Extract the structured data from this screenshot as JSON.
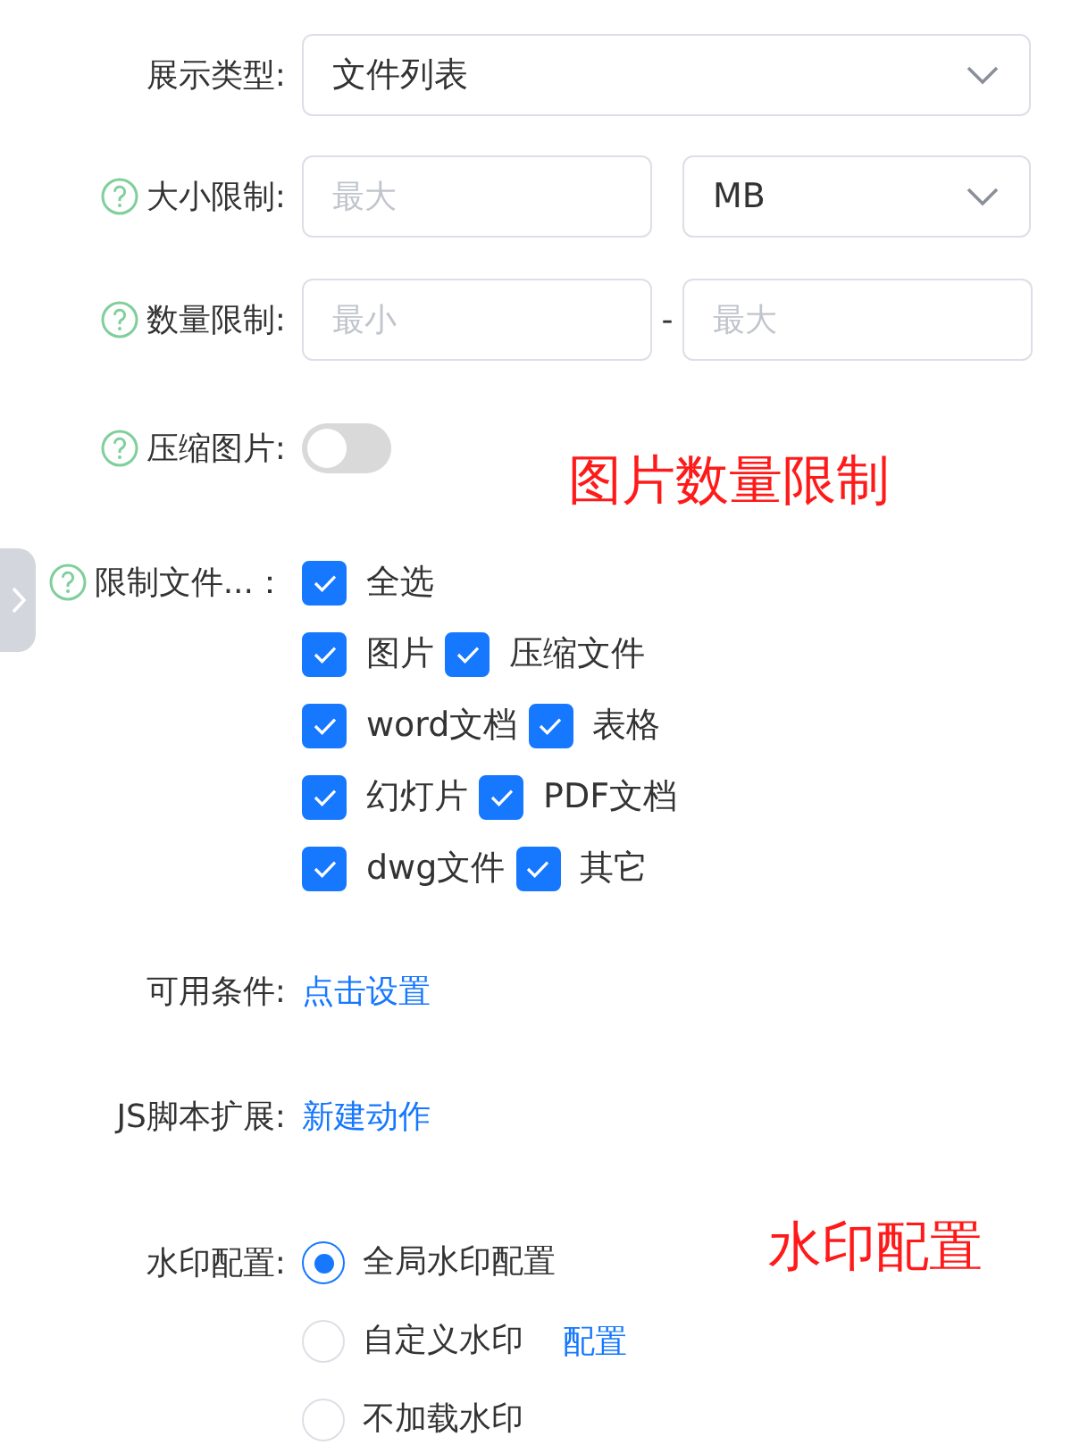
{
  "rows": [
    {
      "kind": "select",
      "label": "展示类型:",
      "help": false,
      "value": "文件列表"
    },
    {
      "kind": "size",
      "label": "大小限制:",
      "help": true,
      "placeholder": "最大",
      "unit": "MB"
    },
    {
      "kind": "range",
      "label": "数量限制:",
      "help": true,
      "min_placeholder": "最小",
      "separator": "-",
      "max_placeholder": "最大"
    },
    {
      "kind": "switch",
      "label": "压缩图片:",
      "help": true,
      "on": false,
      "annotation": "图片数量限制"
    },
    {
      "kind": "checkboxes",
      "label": "限制文件...：",
      "help": true,
      "lines": [
        [
          {
            "label": "全选",
            "checked": true
          }
        ],
        [
          {
            "label": "图片",
            "checked": true
          },
          {
            "label": "压缩文件",
            "checked": true
          }
        ],
        [
          {
            "label": "word文档",
            "checked": true
          },
          {
            "label": "表格",
            "checked": true
          }
        ],
        [
          {
            "label": "幻灯片",
            "checked": true
          },
          {
            "label": "PDF文档",
            "checked": true
          }
        ],
        [
          {
            "label": "dwg文件",
            "checked": true
          },
          {
            "label": "其它",
            "checked": true
          }
        ]
      ]
    },
    {
      "kind": "link",
      "label": "可用条件:",
      "help": false,
      "link": "点击设置"
    },
    {
      "kind": "link",
      "label": "JS脚本扩展:",
      "help": false,
      "link": "新建动作"
    },
    {
      "kind": "radios",
      "label": "水印配置:",
      "help": false,
      "annotation": "水印配置",
      "options": [
        {
          "label": "全局水印配置",
          "selected": true
        },
        {
          "label": "自定义水印",
          "selected": false,
          "link": "配置"
        },
        {
          "label": "不加载水印",
          "selected": false
        }
      ]
    }
  ]
}
